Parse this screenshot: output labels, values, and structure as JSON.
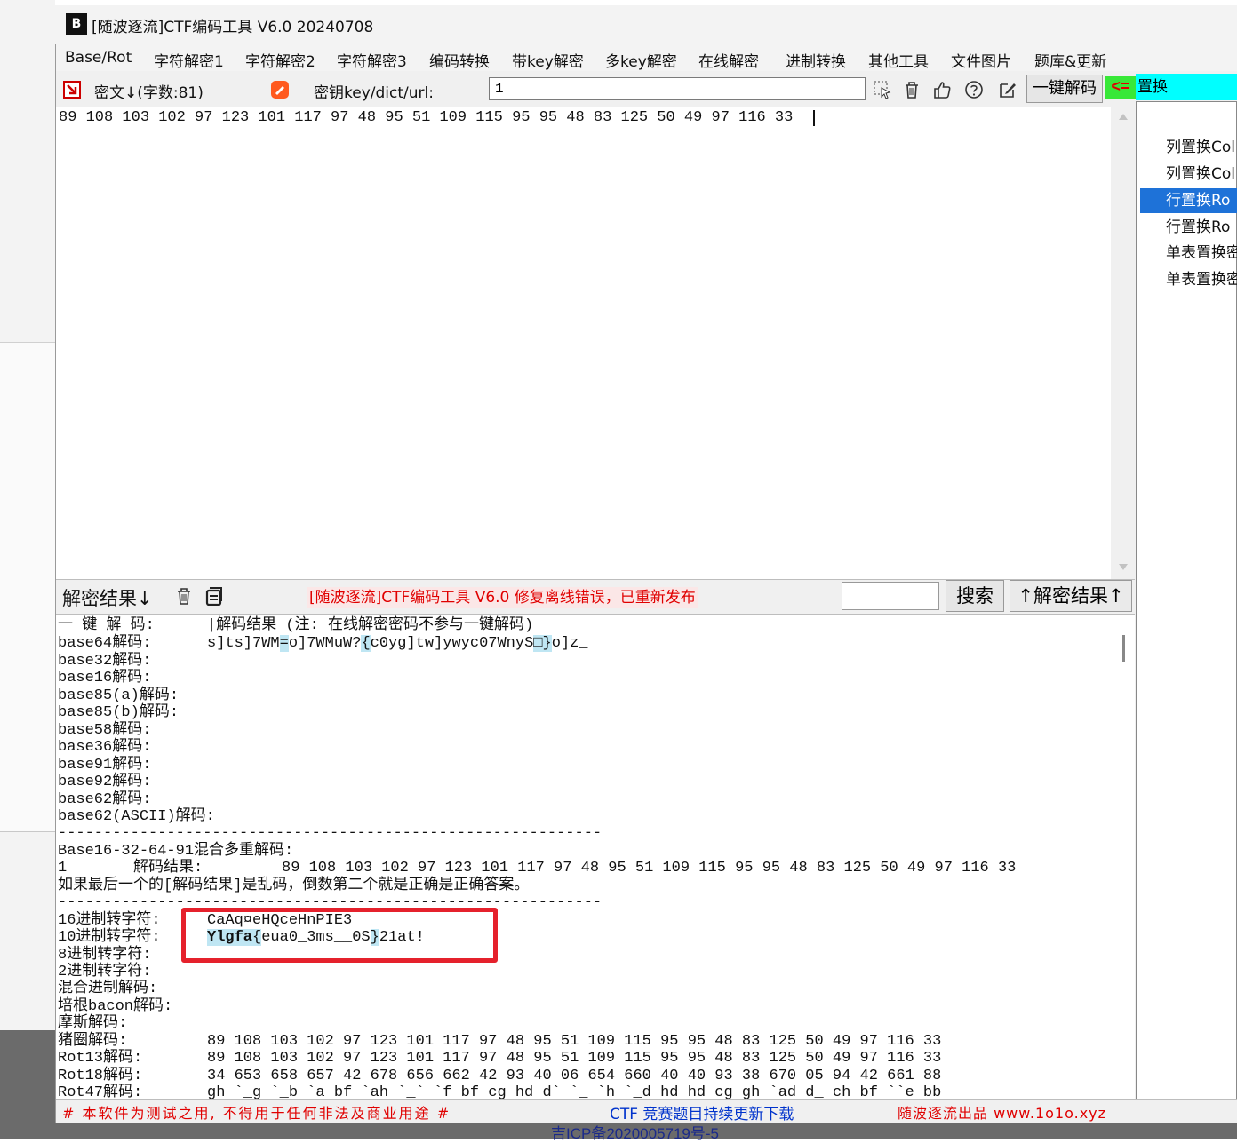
{
  "window": {
    "title": "[随波逐流]CTF编码工具 V6.0 20240708",
    "logo_text": "B"
  },
  "menu": [
    "Base/Rot",
    "字符解密1",
    "字符解密2",
    "字符解密3",
    "编码转换",
    "带key解密",
    "多key解密",
    "在线解密",
    "进制转换",
    "其他工具",
    "文件图片",
    "题库&更新"
  ],
  "toolbar": {
    "cipher_label": "密文↓(字数:81)",
    "key_label": "密钥key/dict/url:",
    "key_value": "1",
    "onekey_button": "一键解码",
    "arrow_label": "<=",
    "selected_method": "置换"
  },
  "input": {
    "text": "89 108 103 102 97 123 101 117 97 48 95 51 109 115 95 95 48 83 125 50 49 97 116 33"
  },
  "method_list": [
    "列置换Col",
    "列置换Col",
    "行置换Ro",
    "行置换Ro",
    "单表置换密",
    "单表置换密"
  ],
  "result_bar": {
    "label": "解密结果↓",
    "notice": "[随波逐流]CTF编码工具 V6.0 修复离线错误，已重新发布",
    "search_button": "搜索",
    "up_button": "↑解密结果↑"
  },
  "results": {
    "header_left": "一 键 解 码:",
    "header_right": "|解码结果 (注: 在线解密密码不参与一键解码)",
    "base64_label": "base64解码:",
    "base64_p1": "s]ts]7WM",
    "base64_h1": "=",
    "base64_p2": "o]7WMuW?",
    "base64_h2": "{",
    "base64_p3": "c0yg]tw]ywyc07WnyS",
    "base64_h3": "□}",
    "base64_p4": "o]z_",
    "labels": [
      "base32解码:",
      "base16解码:",
      "base85(a)解码:",
      "base85(b)解码:",
      "base58解码:",
      "base36解码:",
      "base91解码:",
      "base92解码:",
      "base62解码:",
      "base62(ASCII)解码:"
    ],
    "separator": "------------------------------------------------------------",
    "mixed_title": "Base16-32-64-91混合多重解码:",
    "mixed_idx": "1",
    "mixed_label": "解码结果:",
    "mixed_value": "89 108 103 102 97 123 101 117 97 48 95 51 109 115 95 95 48 83 125 50 49 97 116 33",
    "mixed_note": "如果最后一个的[解码结果]是乱码，倒数第二个就是正确是正确答案。",
    "hex_label": "16进制转字符:",
    "hex_value": "CaAq¤eHQceHnPIE3",
    "dec_label": "10进制转字符:",
    "dec_v1": "Ylgfa",
    "dec_v2": "{",
    "dec_v3": "eua0_3ms__0S",
    "dec_v4": "}",
    "dec_v5": "21at!",
    "oct_label": "8进制转字符:",
    "bin_label": "2进制转字符:",
    "mixbase_label": "混合进制解码:",
    "bacon_label": "培根bacon解码:",
    "morse_label": "摩斯解码:",
    "pigpen_label": "猪圈解码:",
    "pigpen_value": "89 108 103 102 97 123 101 117 97 48 95 51 109 115 95 95 48 83 125 50 49 97 116 33",
    "rot13_label": "Rot13解码:",
    "rot13_value": "89 108 103 102 97 123 101 117 97 48 95 51 109 115 95 95 48 83 125 50 49 97 116 33",
    "rot18_label": "Rot18解码:",
    "rot18_value": "34 653 658 657 42 678 656 662 42 93 40 06 654 660 40 40 93 38 670 05 94 42 661 88",
    "rot47_label": "Rot47解码:",
    "rot47_value": "gh `_g `_b `a bf `ah `_` `f bf cg hd d` `_ `h `_d hd hd cg gh `ad d_ ch bf ``e bb"
  },
  "status": {
    "left": "# 本软件为测试之用, 不得用于任何非法及商业用途 #",
    "middle": "CTF 竞赛题目持续更新下载",
    "right": "随波逐流出品 www.1o1o.xyz",
    "bottom": "吉ICP备2020005719号-5"
  },
  "colors": {
    "selected_method_bg": "#00ffff",
    "list_selected_bg": "#1e72d8",
    "highlight_box": "#e5212c",
    "notice_text": "#e00000"
  }
}
